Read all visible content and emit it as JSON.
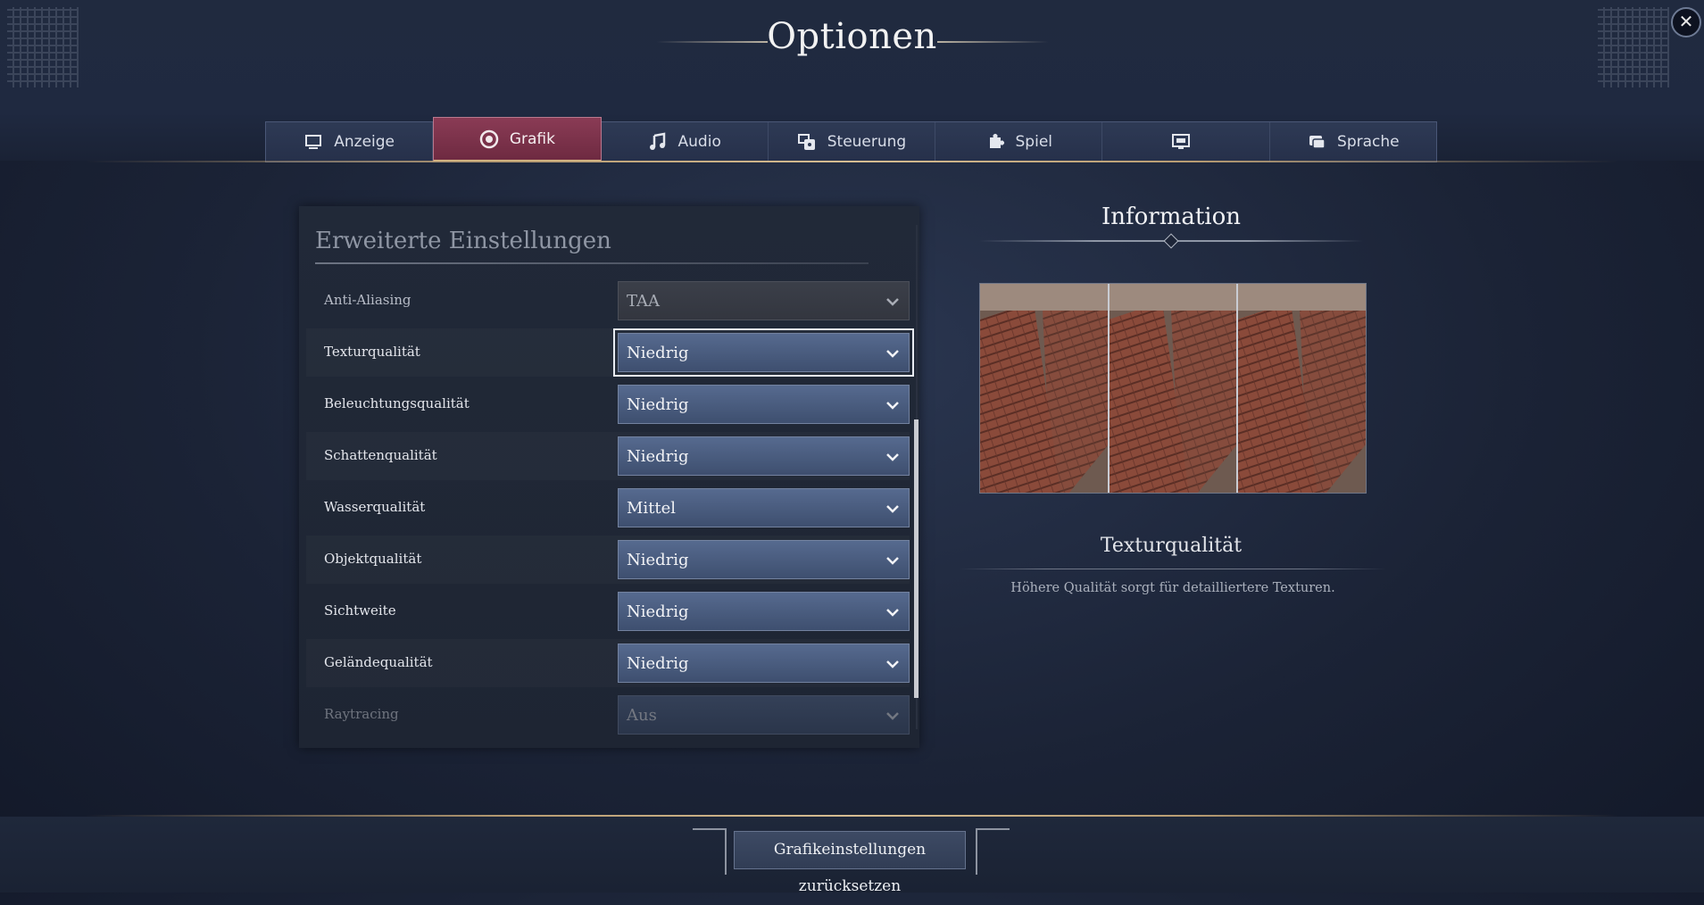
{
  "window": {
    "title": "Optionen",
    "close_icon": "close-icon"
  },
  "tabs": [
    {
      "label": "Anzeige",
      "icon": "monitor-icon",
      "active": false
    },
    {
      "label": "Grafik",
      "icon": "eye-icon",
      "active": true
    },
    {
      "label": "Audio",
      "icon": "music-note-icon",
      "active": false
    },
    {
      "label": "Steuerung",
      "icon": "controller-icon",
      "active": false
    },
    {
      "label": "Spiel",
      "icon": "puzzle-icon",
      "active": false
    },
    {
      "label": "",
      "icon": "screen-icon",
      "active": false
    },
    {
      "label": "Sprache",
      "icon": "speech-bubble-icon",
      "active": false
    }
  ],
  "settings": {
    "section_title": "Erweiterte Einstellungen",
    "rows": [
      {
        "label": "Anti-Aliasing",
        "value": "TAA",
        "state": "disabled"
      },
      {
        "label": "Texturqualität",
        "value": "Niedrig",
        "state": "focused"
      },
      {
        "label": "Beleuchtungsqualität",
        "value": "Niedrig",
        "state": "normal"
      },
      {
        "label": "Schattenqualität",
        "value": "Niedrig",
        "state": "normal"
      },
      {
        "label": "Wasserqualität",
        "value": "Mittel",
        "state": "normal"
      },
      {
        "label": "Objektqualität",
        "value": "Niedrig",
        "state": "normal"
      },
      {
        "label": "Sichtweite",
        "value": "Niedrig",
        "state": "normal"
      },
      {
        "label": "Geländequalität",
        "value": "Niedrig",
        "state": "normal"
      },
      {
        "label": "Raytracing",
        "value": "Aus",
        "state": "faded"
      }
    ]
  },
  "info": {
    "title": "Information",
    "setting_name": "Texturqualität",
    "description": "Höhere Qualität sorgt für detailliertere Texturen."
  },
  "footer": {
    "reset_label": "Grafikeinstellungen zurücksetzen"
  },
  "colors": {
    "accent_tab": "#7a3149",
    "dropdown": "#4a5b7d",
    "gold": "#c7ac80"
  }
}
